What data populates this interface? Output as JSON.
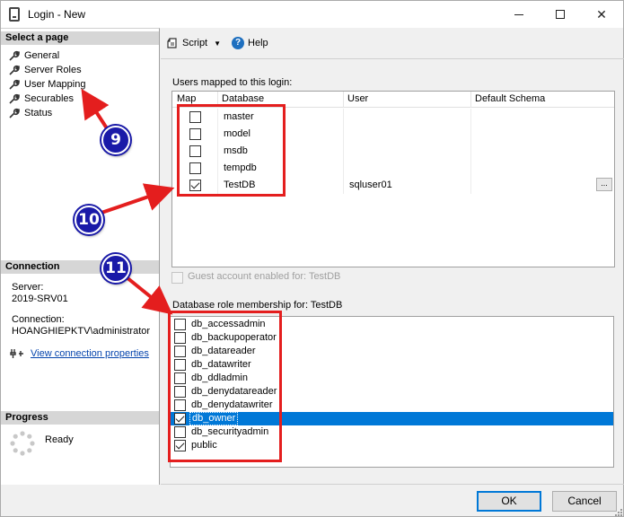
{
  "window": {
    "title": "Login - New"
  },
  "left_panel": {
    "select_page_header": "Select a page",
    "nav_items": [
      "General",
      "Server Roles",
      "User Mapping",
      "Securables",
      "Status"
    ],
    "connection_header": "Connection",
    "server_label": "Server:",
    "server_value": "2019-SRV01",
    "connection_label": "Connection:",
    "connection_value": "HOANGHIEPKTV\\administrator",
    "view_connection_properties": "View connection properties",
    "progress_header": "Progress",
    "progress_status": "Ready"
  },
  "toolbar": {
    "script_label": "Script",
    "help_label": "Help"
  },
  "users_mapped": {
    "label": "Users mapped to this login:",
    "columns": [
      "Map",
      "Database",
      "User",
      "Default Schema"
    ],
    "rows": [
      {
        "database": "master",
        "checked": false,
        "user": ""
      },
      {
        "database": "model",
        "checked": false,
        "user": ""
      },
      {
        "database": "msdb",
        "checked": false,
        "user": ""
      },
      {
        "database": "tempdb",
        "checked": false,
        "user": ""
      },
      {
        "database": "TestDB",
        "checked": true,
        "user": "sqluser01"
      }
    ],
    "ellipsis": "..."
  },
  "guest_account_label": "Guest account enabled for: TestDB",
  "role_membership": {
    "label": "Database role membership for: TestDB",
    "roles": [
      {
        "name": "db_accessadmin",
        "checked": false
      },
      {
        "name": "db_backupoperator",
        "checked": false
      },
      {
        "name": "db_datareader",
        "checked": false
      },
      {
        "name": "db_datawriter",
        "checked": false
      },
      {
        "name": "db_ddladmin",
        "checked": false
      },
      {
        "name": "db_denydatareader",
        "checked": false
      },
      {
        "name": "db_denydatawriter",
        "checked": false
      },
      {
        "name": "db_owner",
        "checked": true
      },
      {
        "name": "db_securityadmin",
        "checked": false
      },
      {
        "name": "public",
        "checked": true
      }
    ],
    "selected_role": "db_owner"
  },
  "buttons": {
    "ok": "OK",
    "cancel": "Cancel"
  },
  "annotations": {
    "badge_9": "9",
    "badge_10": "10",
    "badge_11": "11",
    "color": "#e41e1e",
    "badge_color": "#1a1aa8"
  },
  "colors": {
    "selection": "#0078d7",
    "link": "#0645ad"
  }
}
